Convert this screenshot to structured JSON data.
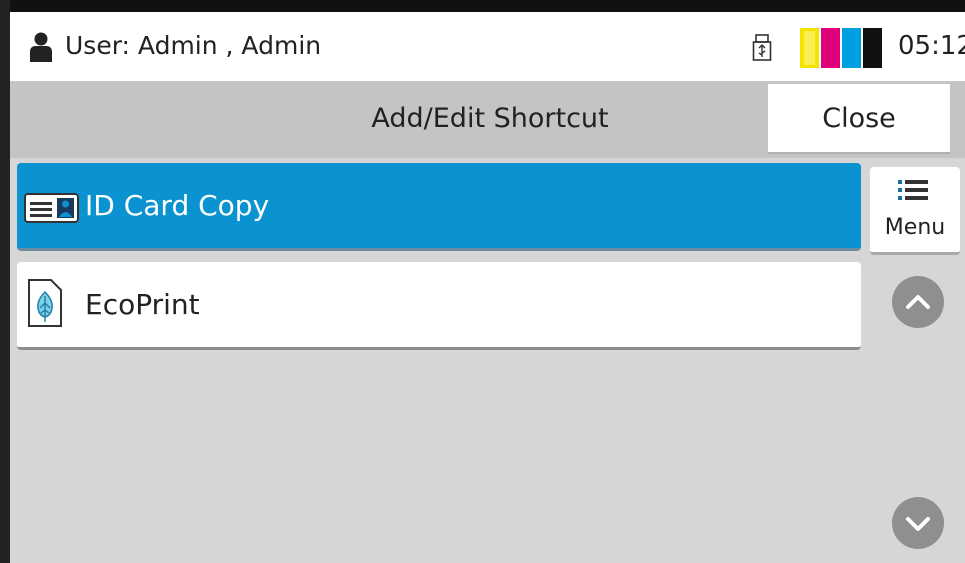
{
  "status_bar": {
    "user": "User: Admin , Admin",
    "time": "05:12",
    "icons": [
      "user-icon",
      "usb-icon",
      "toner-level-icon"
    ]
  },
  "header": {
    "title": "Add/Edit Shortcut",
    "close_label": "Close"
  },
  "shortcuts": [
    {
      "label": "ID Card Copy",
      "icon": "id-card-icon",
      "selected": true
    },
    {
      "label": "EcoPrint",
      "icon": "eco-leaf-icon",
      "selected": false
    }
  ],
  "side_panel": {
    "menu_label": "Menu",
    "menu_icon": "list-icon",
    "scroll_up_icon": "chevron-up-icon",
    "scroll_down_icon": "chevron-down-icon"
  },
  "colors": {
    "selected_item": "#0a93d0",
    "toner": [
      "#f5e400",
      "#e0007a",
      "#00a0e0",
      "#111111"
    ]
  }
}
